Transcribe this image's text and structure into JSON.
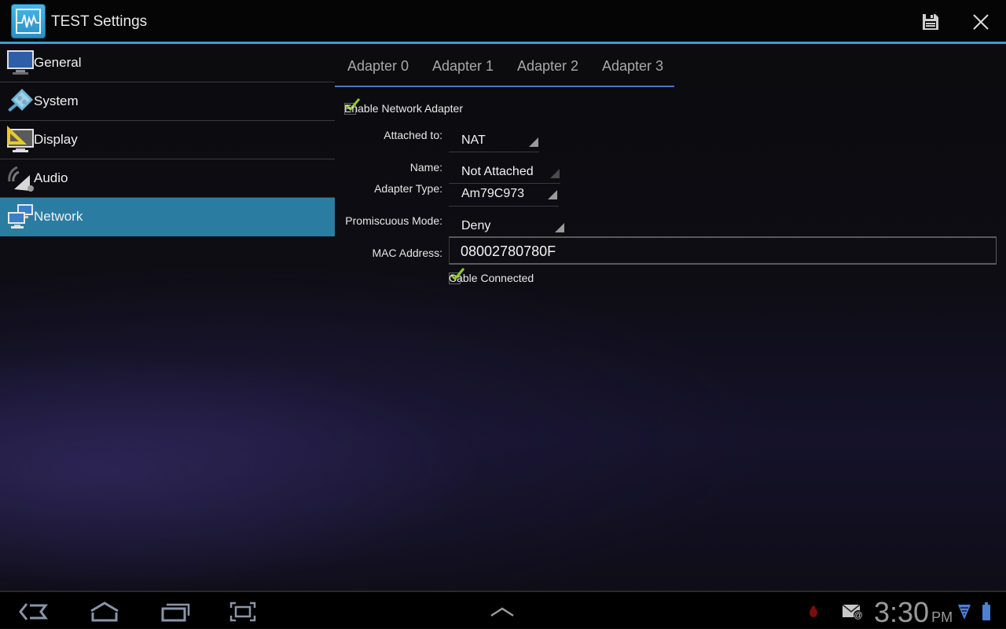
{
  "app": {
    "title": "TEST Settings",
    "icon": "app-waveform-icon",
    "actions": [
      {
        "name": "save",
        "icon": "floppy-disk-icon"
      },
      {
        "name": "close",
        "icon": "close-x-icon"
      }
    ]
  },
  "sidebar": {
    "items": [
      {
        "label": "General",
        "icon": "monitor-icon",
        "active": false
      },
      {
        "label": "System",
        "icon": "system-tools-icon",
        "active": false
      },
      {
        "label": "Display",
        "icon": "display-ruler-icon",
        "active": false
      },
      {
        "label": "Audio",
        "icon": "speaker-icon",
        "active": false
      },
      {
        "label": "Network",
        "icon": "network-computers-icon",
        "active": true
      }
    ],
    "active_color": "#2a7da0"
  },
  "tabs": [
    {
      "label": "Adapter 0",
      "selected": true
    },
    {
      "label": "Adapter 1",
      "selected": false
    },
    {
      "label": "Adapter 2",
      "selected": false
    },
    {
      "label": "Adapter 3",
      "selected": false
    }
  ],
  "form": {
    "enable_adapter": {
      "label": "Enable Network Adapter",
      "checked": true
    },
    "attached_to": {
      "label": "Attached to:",
      "value": "NAT"
    },
    "name": {
      "label": "Name:",
      "value": "Not Attached"
    },
    "adapter_type": {
      "label": "Adapter Type:",
      "value": "Am79C973"
    },
    "promiscuous_mode": {
      "label": "Promiscuous Mode:",
      "value": "Deny"
    },
    "mac_address": {
      "label": "MAC Address:",
      "value": "08002780780F"
    },
    "cable_connected": {
      "label": "Cable Connected",
      "checked": true
    }
  },
  "navbar": {
    "buttons": [
      "back",
      "home",
      "recent-apps",
      "screenshot"
    ],
    "center": "menu-up",
    "status_icons": [
      "debug-bug-icon",
      "email-notification-icon",
      "wifi-icon",
      "battery-icon"
    ],
    "time": "3:30",
    "ampm": "PM"
  },
  "colors": {
    "accent": "#35a0cf",
    "tab_indicator": "#4f74c4",
    "check": "#8fcf1e"
  }
}
